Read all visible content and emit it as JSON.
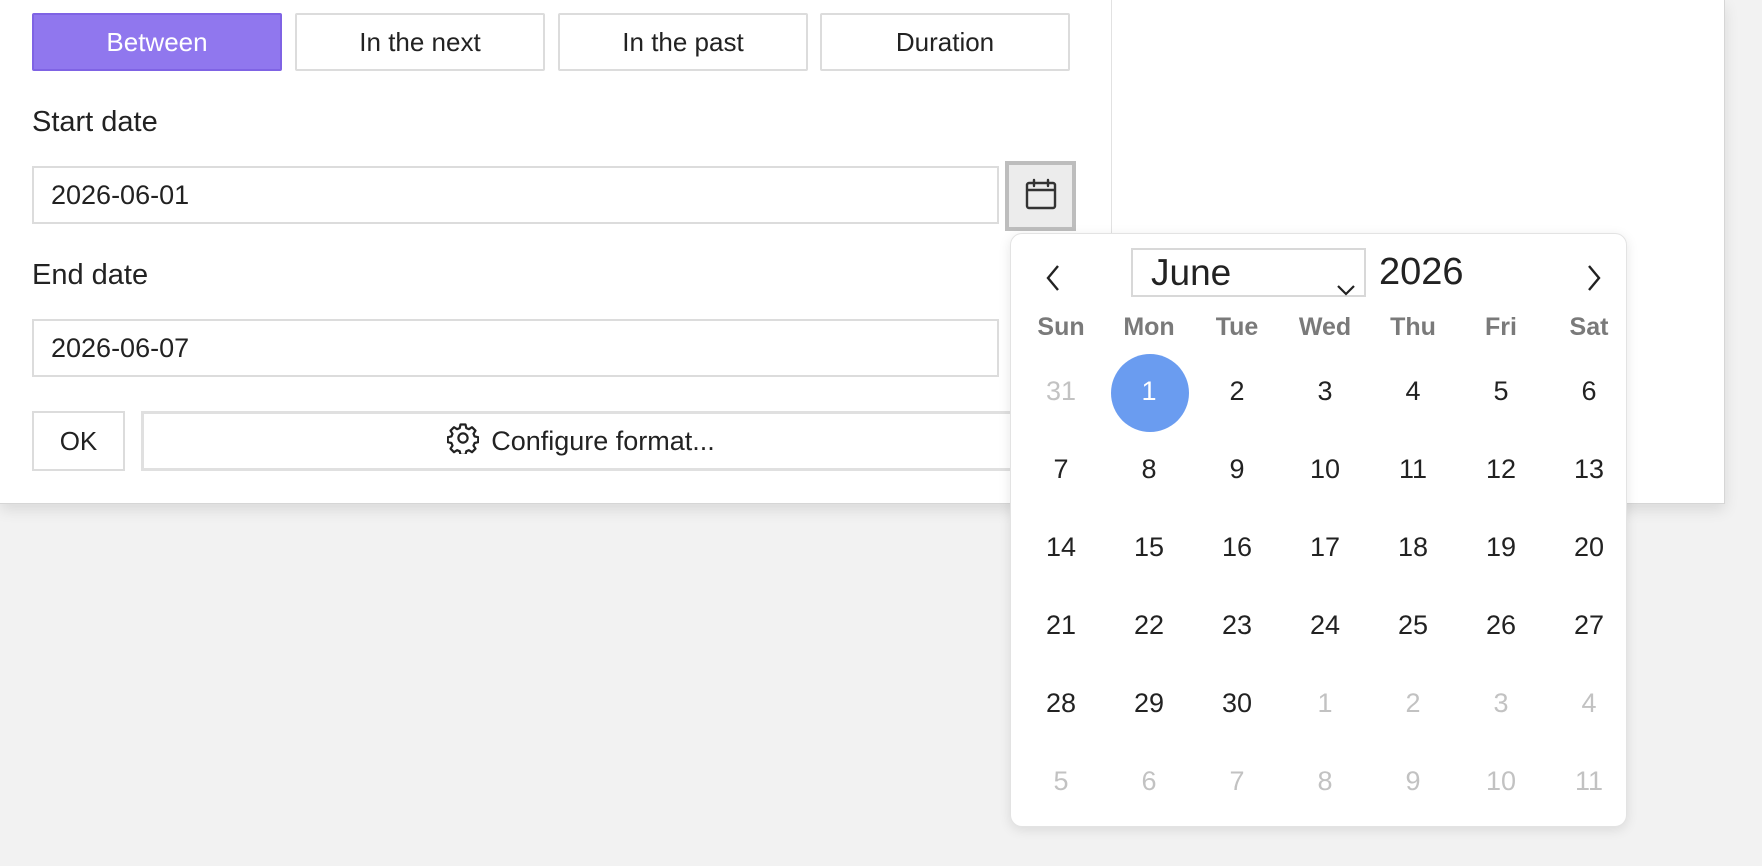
{
  "mode_tabs": [
    {
      "label": "Between",
      "active": true
    },
    {
      "label": "In the next",
      "active": false
    },
    {
      "label": "In the past",
      "active": false
    },
    {
      "label": "Duration",
      "active": false
    }
  ],
  "start_date": {
    "label": "Start date",
    "value": "2026-06-01"
  },
  "end_date": {
    "label": "End date",
    "value": "2026-06-07"
  },
  "actions": {
    "ok_label": "OK",
    "configure_label": "Configure format..."
  },
  "icons": {
    "calendar": "calendar-icon",
    "gear": "gear-icon",
    "prev": "chevron-left-icon",
    "next": "chevron-right-icon",
    "dropdown": "chevron-down-icon"
  },
  "colors": {
    "accent": "#9077ee",
    "selected_day": "#6a9cf0"
  },
  "datepicker": {
    "month": "June",
    "year": "2026",
    "weekdays": [
      "Sun",
      "Mon",
      "Tue",
      "Wed",
      "Thu",
      "Fri",
      "Sat"
    ],
    "weeks": [
      [
        {
          "d": "31",
          "o": true
        },
        {
          "d": "1",
          "s": true
        },
        {
          "d": "2"
        },
        {
          "d": "3"
        },
        {
          "d": "4"
        },
        {
          "d": "5"
        },
        {
          "d": "6"
        }
      ],
      [
        {
          "d": "7"
        },
        {
          "d": "8"
        },
        {
          "d": "9"
        },
        {
          "d": "10"
        },
        {
          "d": "11"
        },
        {
          "d": "12"
        },
        {
          "d": "13"
        }
      ],
      [
        {
          "d": "14"
        },
        {
          "d": "15"
        },
        {
          "d": "16"
        },
        {
          "d": "17"
        },
        {
          "d": "18"
        },
        {
          "d": "19"
        },
        {
          "d": "20"
        }
      ],
      [
        {
          "d": "21"
        },
        {
          "d": "22"
        },
        {
          "d": "23"
        },
        {
          "d": "24"
        },
        {
          "d": "25"
        },
        {
          "d": "26"
        },
        {
          "d": "27"
        }
      ],
      [
        {
          "d": "28"
        },
        {
          "d": "29"
        },
        {
          "d": "30"
        },
        {
          "d": "1",
          "o": true
        },
        {
          "d": "2",
          "o": true
        },
        {
          "d": "3",
          "o": true
        },
        {
          "d": "4",
          "o": true
        }
      ],
      [
        {
          "d": "5",
          "o": true
        },
        {
          "d": "6",
          "o": true
        },
        {
          "d": "7",
          "o": true
        },
        {
          "d": "8",
          "o": true
        },
        {
          "d": "9",
          "o": true
        },
        {
          "d": "10",
          "o": true
        },
        {
          "d": "11",
          "o": true
        }
      ]
    ]
  }
}
